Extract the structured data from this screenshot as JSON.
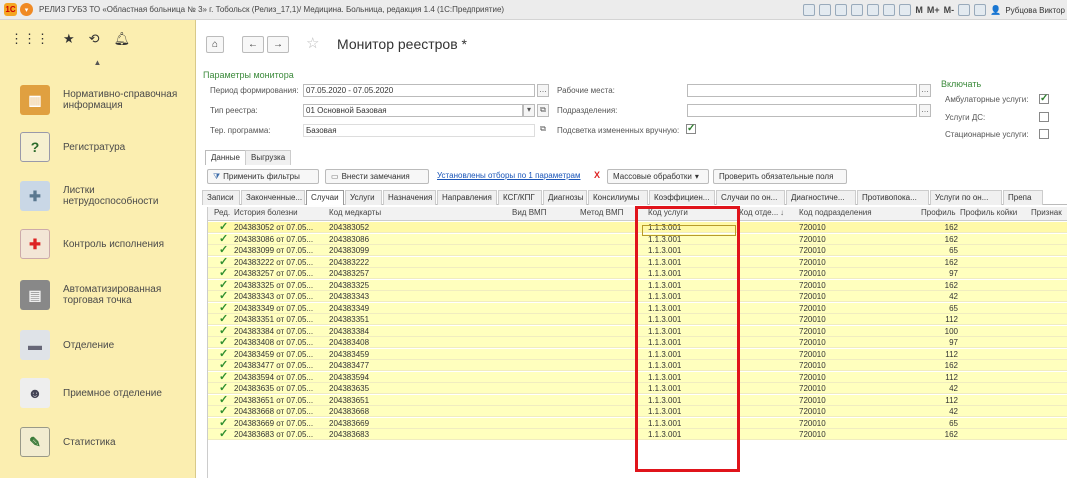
{
  "window": {
    "title": "РЕЛИЗ ГУБЗ ТО «Областная больница № 3» г. Тобольск (Релиз_17,1)/ Медицина. Больница, редакция 1.4 (1С:Предприятие)",
    "toolbar_labels": [
      "M",
      "M+",
      "M-"
    ],
    "user": "Рубцова Виктор"
  },
  "sidebar": {
    "items": [
      {
        "label": "Нормативно-справочная информация",
        "icon": "books-icon"
      },
      {
        "label": "Регистратура",
        "icon": "help-document-icon"
      },
      {
        "label": "Листки нетрудоспособности",
        "icon": "bandage-icon"
      },
      {
        "label": "Контроль исполнения",
        "icon": "first-aid-icon"
      },
      {
        "label": "Автоматизированная торговая точка",
        "icon": "cash-register-icon"
      },
      {
        "label": "Отделение",
        "icon": "hospital-bed-icon"
      },
      {
        "label": "Приемное отделение",
        "icon": "doctor-icon"
      },
      {
        "label": "Статистика",
        "icon": "clipboard-icon"
      }
    ]
  },
  "page": {
    "title": "Монитор реестров *"
  },
  "params": {
    "title": "Параметры монитора",
    "period_label": "Период формирования:",
    "period_value": "07.05.2020 - 07.05.2020",
    "registry_type_label": "Тип реестра:",
    "registry_type_value": "01 Основной Базовая",
    "program_label": "Тер. программа:",
    "program_value": "Базовая",
    "workplaces_label": "Рабочие места:",
    "workplaces_value": "",
    "departments_label": "Подразделения:",
    "departments_value": "",
    "highlight_label": "Подсветка измененных вручную:",
    "highlight_checked": true
  },
  "include": {
    "title": "Включать",
    "outpatient_label": "Амбулаторные услуги:",
    "outpatient_checked": true,
    "ds_label": "Услуги ДС:",
    "ds_checked": false,
    "inpatient_label": "Стационарные услуги:",
    "inpatient_checked": false
  },
  "outer_tabs": [
    "Данные",
    "Выгрузка"
  ],
  "toolbar": {
    "apply_filters": "Применить фильтры",
    "add_remarks": "Внести замечания",
    "filters_link": "Установлены отборы по 1 параметрам",
    "clear_x": "X",
    "mass_processing": "Массовые обработки",
    "check_required": "Проверить обязательные поля"
  },
  "inner_tabs": [
    "Записи",
    "Законченные...",
    "Случаи",
    "Услуги",
    "Назначения",
    "Направления",
    "КСГ/КПГ",
    "Диагнозы",
    "Консилиумы",
    "Коэффициен...",
    "Случаи по он...",
    "Диагностиче...",
    "Противопока...",
    "Услуги по он...",
    "Препа"
  ],
  "grid": {
    "headers": {
      "red": "Ред.",
      "history": "История болезни",
      "medcard": "Код медкарты",
      "vmp_type": "Вид ВМП",
      "vmp_method": "Метод ВМП",
      "service_code": "Код услуги",
      "dept_code_short": "Код отде...",
      "dept_code": "Код подразделения",
      "profile": "Профиль",
      "bed_profile": "Профиль койки",
      "sign": "Признак"
    },
    "rows": [
      {
        "history": "204383052 от 07.05...",
        "card": "204383052",
        "service": "1.1.3.001",
        "dept": "720010",
        "profile": "162"
      },
      {
        "history": "204383086 от 07.05...",
        "card": "204383086",
        "service": "1.1.3.001",
        "dept": "720010",
        "profile": "162"
      },
      {
        "history": "204383099 от 07.05...",
        "card": "204383099",
        "service": "1.1.3.001",
        "dept": "720010",
        "profile": "65"
      },
      {
        "history": "204383222 от 07.05...",
        "card": "204383222",
        "service": "1.1.3.001",
        "dept": "720010",
        "profile": "162"
      },
      {
        "history": "204383257 от 07.05...",
        "card": "204383257",
        "service": "1.1.3.001",
        "dept": "720010",
        "profile": "97"
      },
      {
        "history": "204383325 от 07.05...",
        "card": "204383325",
        "service": "1.1.3.001",
        "dept": "720010",
        "profile": "162"
      },
      {
        "history": "204383343 от 07.05...",
        "card": "204383343",
        "service": "1.1.3.001",
        "dept": "720010",
        "profile": "42"
      },
      {
        "history": "204383349 от 07.05...",
        "card": "204383349",
        "service": "1.1.3.001",
        "dept": "720010",
        "profile": "65"
      },
      {
        "history": "204383351 от 07.05...",
        "card": "204383351",
        "service": "1.1.3.001",
        "dept": "720010",
        "profile": "112"
      },
      {
        "history": "204383384 от 07.05...",
        "card": "204383384",
        "service": "1.1.3.001",
        "dept": "720010",
        "profile": "100"
      },
      {
        "history": "204383408 от 07.05...",
        "card": "204383408",
        "service": "1.1.3.001",
        "dept": "720010",
        "profile": "97"
      },
      {
        "history": "204383459 от 07.05...",
        "card": "204383459",
        "service": "1.1.3.001",
        "dept": "720010",
        "profile": "112"
      },
      {
        "history": "204383477 от 07.05...",
        "card": "204383477",
        "service": "1.1.3.001",
        "dept": "720010",
        "profile": "162"
      },
      {
        "history": "204383594 от 07.05...",
        "card": "204383594",
        "service": "1.1.3.001",
        "dept": "720010",
        "profile": "112"
      },
      {
        "history": "204383635 от 07.05...",
        "card": "204383635",
        "service": "1.1.3.001",
        "dept": "720010",
        "profile": "42"
      },
      {
        "history": "204383651 от 07.05...",
        "card": "204383651",
        "service": "1.1.3.001",
        "dept": "720010",
        "profile": "112"
      },
      {
        "history": "204383668 от 07.05...",
        "card": "204383668",
        "service": "1.1.3.001",
        "dept": "720010",
        "profile": "42"
      },
      {
        "history": "204383669 от 07.05...",
        "card": "204383669",
        "service": "1.1.3.001",
        "dept": "720010",
        "profile": "65"
      },
      {
        "history": "204383683 от 07.05...",
        "card": "204383683",
        "service": "1.1.3.001",
        "dept": "720010",
        "profile": "162"
      }
    ]
  },
  "colors": {
    "sidebar_bg": "#fbeeb0",
    "row_bg": "#ffffbe",
    "accent_green": "#3b8a3b",
    "highlight_red": "#e0141b",
    "link_blue": "#1a55b8"
  }
}
